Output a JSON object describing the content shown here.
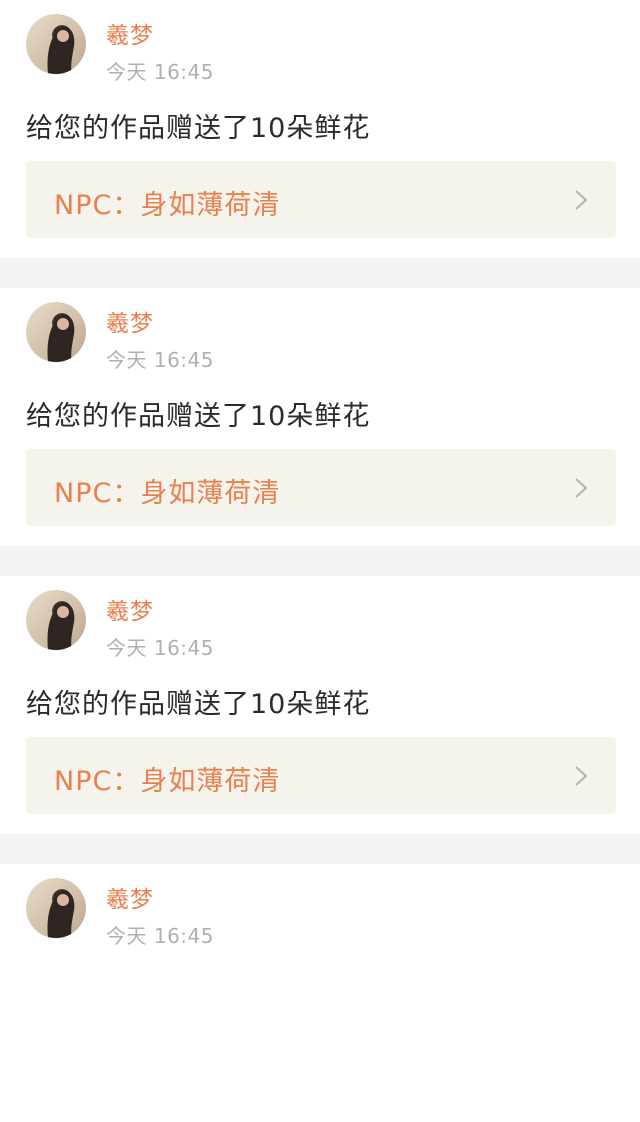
{
  "feed": {
    "items": [
      {
        "username": "羲梦",
        "time": "今天 16:45",
        "message": "给您的作品赠送了10朵鲜花",
        "link": "NPC：身如薄荷清"
      },
      {
        "username": "羲梦",
        "time": "今天 16:45",
        "message": "给您的作品赠送了10朵鲜花",
        "link": "NPC：身如薄荷清"
      },
      {
        "username": "羲梦",
        "time": "今天 16:45",
        "message": "给您的作品赠送了10朵鲜花",
        "link": "NPC：身如薄荷清"
      },
      {
        "username": "羲梦",
        "time": "今天 16:45"
      }
    ]
  },
  "colors": {
    "accent": "#e8814f",
    "muted": "#b0b0b0",
    "text": "#2b2b2b",
    "link_bg": "#f4f4ec",
    "page_bg": "#f3f3f1"
  },
  "icons": {
    "avatar": "avatar-photo",
    "chevron": "chevron-right-icon"
  }
}
